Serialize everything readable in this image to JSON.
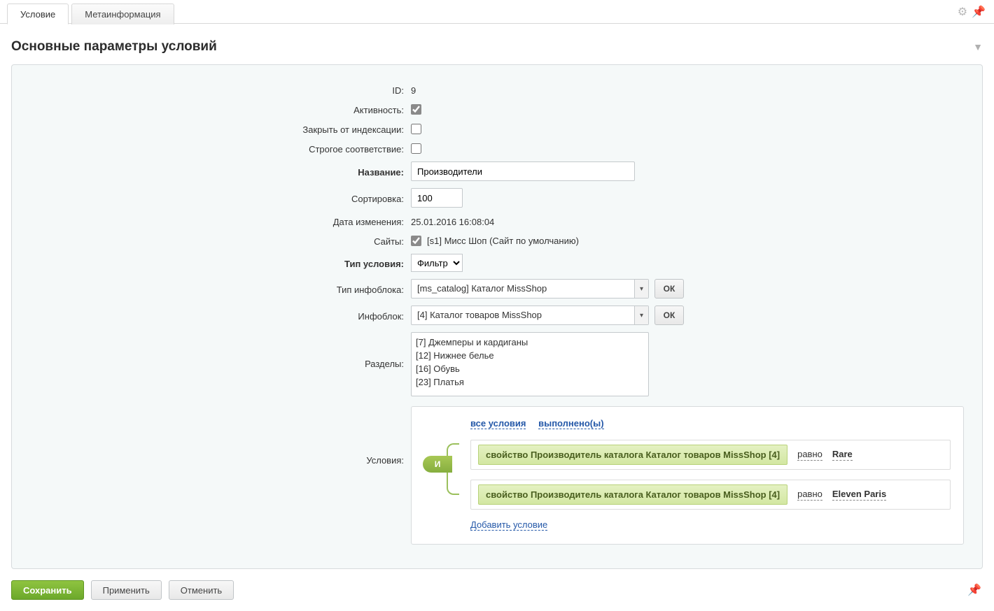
{
  "tabs": {
    "items": [
      {
        "label": "Условие",
        "active": true
      },
      {
        "label": "Метаинформация",
        "active": false
      }
    ]
  },
  "section_title": "Основные параметры условий",
  "form": {
    "id_label": "ID:",
    "id_value": "9",
    "active_label": "Активность:",
    "active_checked": true,
    "noindex_label": "Закрыть от индексации:",
    "noindex_checked": false,
    "strict_label": "Строгое соответствие:",
    "strict_checked": false,
    "name_label": "Название:",
    "name_value": "Производители",
    "sort_label": "Сортировка:",
    "sort_value": "100",
    "modified_label": "Дата изменения:",
    "modified_value": "25.01.2016 16:08:04",
    "sites_label": "Сайты:",
    "sites_checked": true,
    "sites_text": "[s1] Мисс Шоп (Сайт по умолчанию)",
    "cond_type_label": "Тип условия:",
    "cond_type_value": "Фильтр",
    "iblock_type_label": "Тип инфоблока:",
    "iblock_type_value": "[ms_catalog] Каталог MissShop",
    "iblock_label": "Инфоблок:",
    "iblock_value": "[4] Каталог товаров MissShop",
    "ok_label": "ОК",
    "sections_label": "Разделы:",
    "sections_items": [
      "[7] Джемперы и кардиганы",
      "[12] Нижнее белье",
      "[16] Обувь",
      "[23] Платья"
    ],
    "conditions_label": "Условия:"
  },
  "conditions": {
    "all_label": "все условия",
    "done_label": "выполнено(ы)",
    "and_label": "И",
    "add_label": "Добавить условие",
    "rules": [
      {
        "property": "свойство Производитель каталога Каталог товаров MissShop [4]",
        "operator": "равно",
        "value": "Rare"
      },
      {
        "property": "свойство Производитель каталога Каталог товаров MissShop [4]",
        "operator": "равно",
        "value": "Eleven Paris"
      }
    ]
  },
  "buttons": {
    "save": "Сохранить",
    "apply": "Применить",
    "cancel": "Отменить"
  }
}
